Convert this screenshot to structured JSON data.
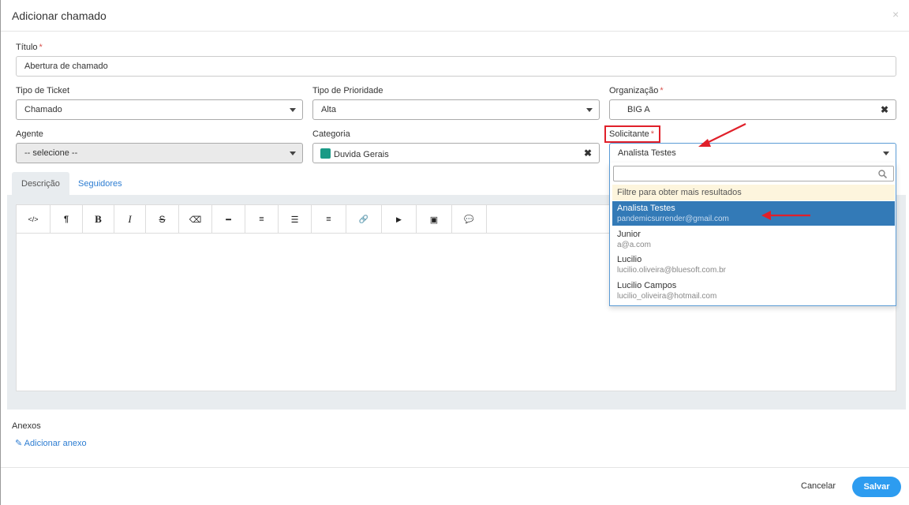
{
  "modal": {
    "title": "Adicionar chamado",
    "close": "×"
  },
  "fields": {
    "titulo": {
      "label": "Título",
      "required": "*",
      "value": "Abertura de chamado"
    },
    "tipo_ticket": {
      "label": "Tipo de Ticket",
      "value": "Chamado"
    },
    "tipo_prioridade": {
      "label": "Tipo de Prioridade",
      "value": "Alta"
    },
    "organizacao": {
      "label": "Organização",
      "required": "*",
      "value": "BIG A",
      "clear": "✖"
    },
    "agente": {
      "label": "Agente",
      "value": "-- selecione --"
    },
    "categoria": {
      "label": "Categoria",
      "value": "Duvida Gerais",
      "clear": "✖",
      "color": "#1a9a86"
    },
    "solicitante": {
      "label": "Solicitante",
      "required": "*",
      "value": "Analista Testes"
    }
  },
  "tabs": [
    {
      "label": "Descrição",
      "active": true
    },
    {
      "label": "Seguidores",
      "active": false
    }
  ],
  "toolbar": {
    "code": "</>",
    "paragraph": "¶",
    "bold": "B",
    "italic": "I",
    "strike": "S",
    "clear": "⌫",
    "hr": "━",
    "ordered_list": "≡",
    "unordered_list": "☰",
    "align": "≡",
    "link": "🔗",
    "video": "▶",
    "image": "▣",
    "comment": "💬"
  },
  "dropdown": {
    "hint": "Filtre para obter mais resultados",
    "options": [
      {
        "name": "Analista Testes",
        "email": "pandemicsurrender@gmail.com",
        "selected": true
      },
      {
        "name": "Junior",
        "email": "a@a.com",
        "selected": false
      },
      {
        "name": "Lucilio",
        "email": "lucilio.oliveira@bluesoft.com.br",
        "selected": false
      },
      {
        "name": "Lucilio Campos",
        "email": "lucilio_oliveira@hotmail.com",
        "selected": false
      }
    ]
  },
  "anexos": {
    "label": "Anexos",
    "link": "Adicionar anexo"
  },
  "footer": {
    "cancel": "Cancelar",
    "save": "Salvar"
  },
  "colors": {
    "accent": "#2d9cf0",
    "selected_option": "#337ab7",
    "annotation": "#e0202a"
  }
}
